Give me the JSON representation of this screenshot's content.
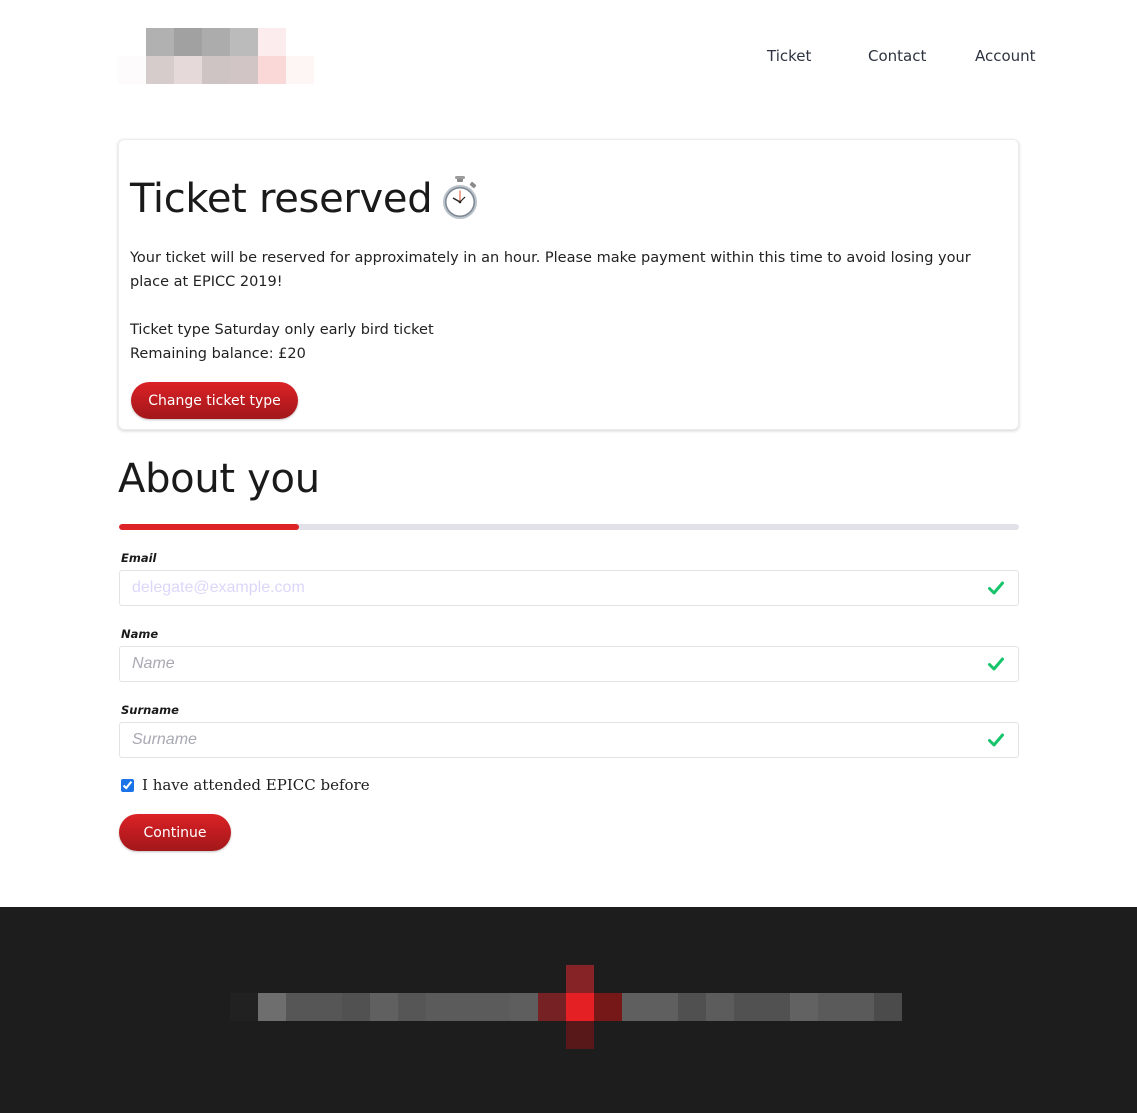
{
  "header": {
    "logo_alt": "EPICC logo (pixelated)",
    "nav": [
      {
        "label": "Ticket"
      },
      {
        "label": "Contact"
      },
      {
        "label": "Account"
      }
    ]
  },
  "reservation_card": {
    "title": "Ticket reserved",
    "title_icon": "stopwatch-icon",
    "message": "Your ticket will be reserved for approximately in an hour. Please make payment within this time to avoid losing your place at EPICC 2019!",
    "ticket_type": "Ticket type Saturday only early bird ticket",
    "remaining_balance": "Remaining balance: £20",
    "change_button_label": "Change ticket type"
  },
  "about_you": {
    "title": "About you",
    "progress_fraction": 0.2,
    "fields": [
      {
        "label": "Email",
        "placeholder": "delegate@example.com",
        "value": "",
        "valid_icon": "check-icon"
      },
      {
        "label": "Name",
        "placeholder": "Name",
        "value": "",
        "valid_icon": "check-icon"
      },
      {
        "label": "Surname",
        "placeholder": "Surname",
        "value": "",
        "valid_icon": "check-icon"
      }
    ],
    "attended_before": {
      "label": "I have attended EPICC before",
      "checked": true
    },
    "continue_label": "Continue"
  },
  "colors": {
    "accent_red": "#de2326",
    "valid_green": "#16c46a",
    "footer_bg": "#1d1d1d",
    "progress_track": "#e2e1ea"
  }
}
